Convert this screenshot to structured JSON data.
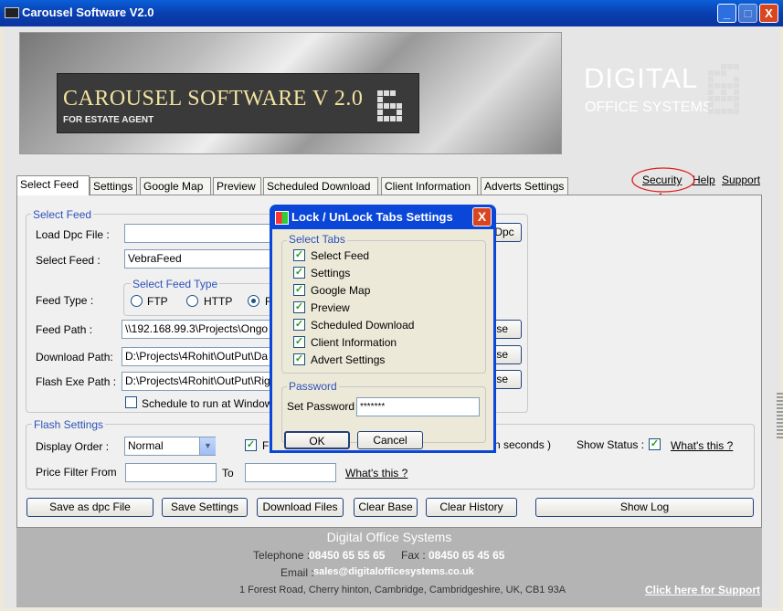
{
  "window": {
    "title": "Carousel Software V2.0",
    "minimize": "_",
    "maximize": "□",
    "close": "X"
  },
  "banner": {
    "title": "CAROUSEL SOFTWARE V 2.0",
    "subtitle": "FOR ESTATE AGENT",
    "brand_line1": "DIGITAL",
    "brand_line2": "OFFICE SYSTEMS"
  },
  "tabs": [
    "Select Feed",
    "Settings",
    "Google Map",
    "Preview",
    "Scheduled Download",
    "Client Information",
    "Adverts Settings"
  ],
  "top_links": {
    "security": "Security",
    "help": "Help",
    "support": "Support"
  },
  "select_feed": {
    "group_title": "Select Feed",
    "load_dpc_label": "Load Dpc File :",
    "load_dpc_value": "",
    "load_dpc_button": "Dpc",
    "select_feed_label": "Select Feed :",
    "select_feed_value": "VebraFeed",
    "feed_type_group": "Select Feed Type",
    "feed_type_label": "Feed Type :",
    "ftp": "FTP",
    "http": "HTTP",
    "third_option": "F",
    "feed_path_label": "Feed Path :",
    "feed_path_value": "\\\\192.168.99.3\\Projects\\Ongo",
    "download_path_label": "Download Path:",
    "download_path_value": "D:\\Projects\\4Rohit\\OutPut\\Da",
    "flash_exe_label": "Flash Exe Path :",
    "flash_exe_value": "D:\\Projects\\4Rohit\\OutPut\\Rig",
    "browse_partial": "se",
    "schedule_text": "Schedule to run at Window"
  },
  "flash_settings": {
    "group_title": "Flash  Settings",
    "display_order_label": "Display Order :",
    "display_order_value": "Normal",
    "partial_check_label": "F",
    "seconds_text": "n seconds )",
    "show_status_label": "Show Status :",
    "whats_this": "What's this ?",
    "price_filter_label": "Price Filter From",
    "to_label": "To",
    "price_from": "",
    "price_to": "",
    "whats_this2": "What's this ?"
  },
  "buttons": {
    "save_dpc": "Save as dpc File",
    "save_settings": "Save Settings",
    "download_files": "Download Files",
    "clear_base": "Clear Base",
    "clear_history": "Clear History",
    "show_log": "Show Log"
  },
  "footer": {
    "company": "Digital Office Systems",
    "telephone_label": "Telephone :",
    "telephone": "08450 65 55 65",
    "fax_label": "Fax :",
    "fax": "08450 65 45 65",
    "email_label": "Email :",
    "email": "sales@digitalofficesystems.co.uk",
    "address": "1 Forest Road, Cherry hinton, Cambridge, Cambridgeshire, UK, CB1 93A",
    "support_link": "Click here for Support"
  },
  "dialog": {
    "title": "Lock / UnLock Tabs Settings",
    "close": "X",
    "tabs_group": "Select Tabs",
    "items": [
      {
        "label": "Select Feed",
        "checked": true
      },
      {
        "label": "Settings",
        "checked": true
      },
      {
        "label": "Google Map",
        "checked": true
      },
      {
        "label": "Preview",
        "checked": true
      },
      {
        "label": "Scheduled Download",
        "checked": true
      },
      {
        "label": "Client Information",
        "checked": true
      },
      {
        "label": "Advert Settings",
        "checked": true
      }
    ],
    "password_group": "Password",
    "password_label": "Set Password :",
    "password_value": "*******",
    "ok": "OK",
    "cancel": "Cancel"
  },
  "colors": {
    "titlebar": "#0a46d8",
    "group_title": "#2e52b8",
    "annotation": "#e02020",
    "checkmark": "#21a121"
  }
}
